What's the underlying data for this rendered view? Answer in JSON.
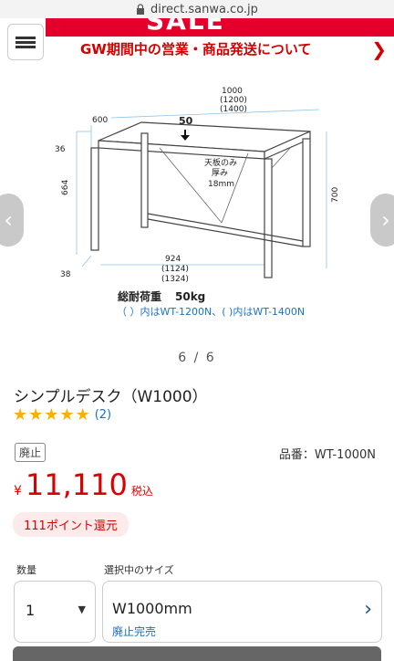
{
  "browser": {
    "url": "direct.sanwa.co.jp"
  },
  "header": {
    "sale_text": "SALE",
    "notice": "GW期間中の営業・商品発送について"
  },
  "gallery": {
    "counter": "6 / 6",
    "diagram": {
      "load_label": "50",
      "width_label": "1000",
      "width_alt1": "(1200)",
      "width_alt2": "(1400)",
      "depth_label": "600",
      "top_thick_label": "36",
      "leg_height_label": "664",
      "height_label": "700",
      "bottom_label": "38",
      "inner_width": "924",
      "inner_alt1": "(1124)",
      "inner_alt2": "(1324)",
      "top_note1": "天板のみ",
      "top_note2": "厚み",
      "top_note3": "18mm",
      "load_total_label": "総耐荷重",
      "load_total_value": "50kg",
      "note": "（ ）内はWT-1200N、( )内はWT-1400N"
    }
  },
  "product": {
    "title": "シンプルデスク（W1000）",
    "review_count": "(2)",
    "rating": 5,
    "badge": "廃止",
    "part_number": "品番：WT-1000N",
    "currency": "¥",
    "price": "11,110",
    "tax_note": "税込",
    "points": "111ポイント還元"
  },
  "options": {
    "qty_label": "数量",
    "qty_value": "1",
    "size_label": "選択中のサイズ",
    "size_value": "W1000mm",
    "size_status": "廃止完売"
  },
  "colors": {
    "accent": "#d80000",
    "link": "#1a6fc4",
    "star": "#f5b301"
  }
}
